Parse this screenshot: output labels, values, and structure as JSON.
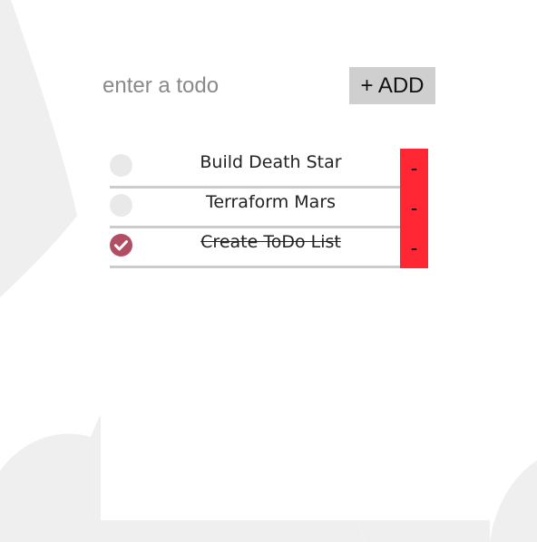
{
  "input": {
    "placeholder": "enter a todo",
    "value": ""
  },
  "add_button": {
    "label": "+ ADD"
  },
  "todos": [
    {
      "text": "Build Death Star",
      "completed": false,
      "delete_label": "-"
    },
    {
      "text": "Terraform Mars",
      "completed": false,
      "delete_label": "-"
    },
    {
      "text": "Create ToDo List",
      "completed": true,
      "delete_label": "-"
    }
  ],
  "colors": {
    "background": "#ffffff",
    "background_shapes": "#efefef",
    "add_button": "#cfcfcf",
    "delete_button": "#ff2733",
    "check_done": "#b24e63",
    "check_empty": "#e9e9e9",
    "divider": "#cccccc"
  },
  "icons": {
    "check": "check-icon"
  }
}
